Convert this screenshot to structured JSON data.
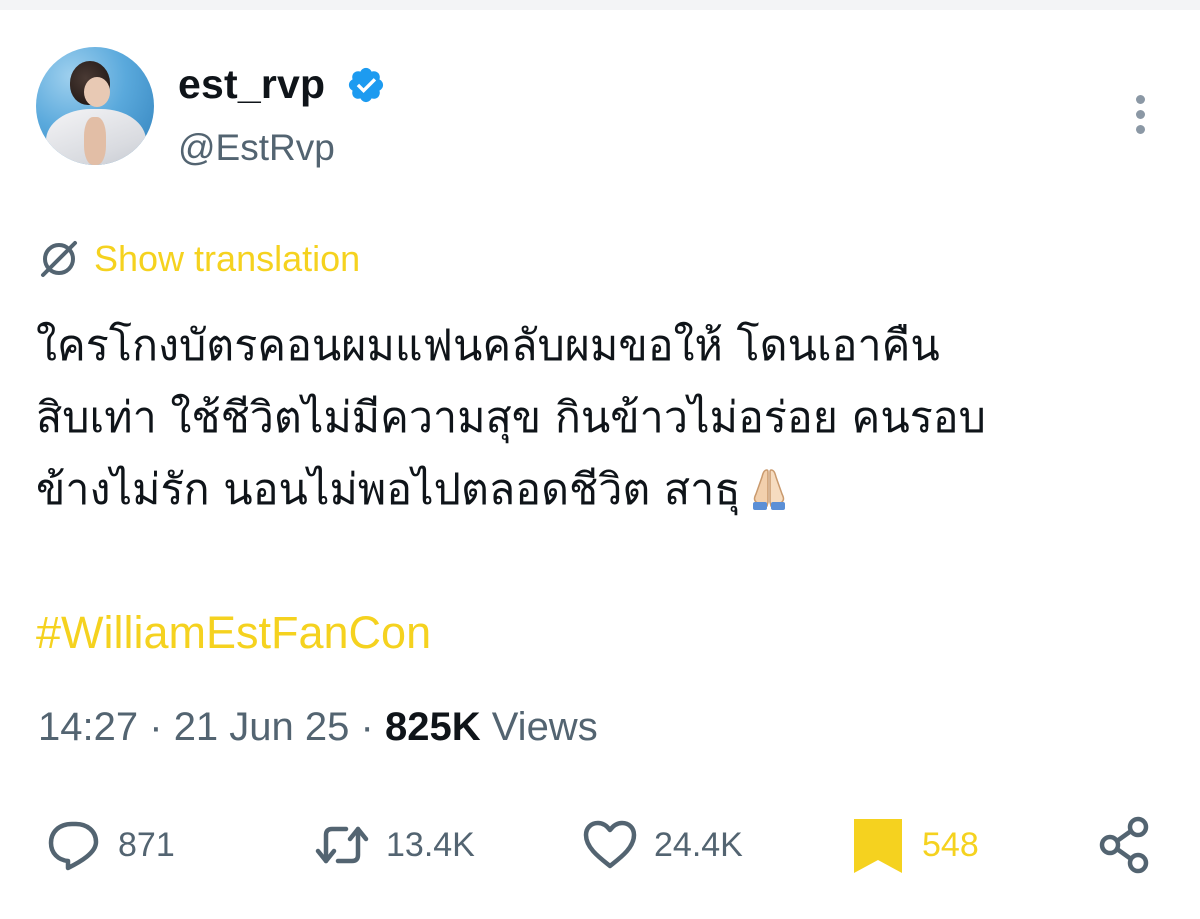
{
  "author": {
    "display_name": "est_rvp",
    "handle": "@EstRvp",
    "verified": true
  },
  "translation": {
    "link_text": "Show translation"
  },
  "tweet": {
    "lines": [
      "ใครโกงบัตรคอนผมแฟนคลับผมขอให้ โดนเอาคืน",
      "สิบเท่า ใช้ชีวิตไม่มีความสุข กินข้าวไม่อร่อย คนรอบ",
      "ข้างไม่รัก นอนไม่พอไปตลอดชีวิต สาธุ"
    ],
    "emoji": "folded-hands",
    "hashtag": "#WilliamEstFanCon"
  },
  "meta": {
    "time": "14:27",
    "separator": "·",
    "date": "21 Jun 25",
    "views_count": "825K",
    "views_label": "Views"
  },
  "actions": {
    "replies": "871",
    "reposts": "13.4K",
    "likes": "24.4K",
    "bookmarks": "548"
  },
  "icons": {
    "verified": "verified-badge-icon",
    "more": "more-vertical-icon",
    "translate": "globe-translate-icon",
    "reply": "reply-bubble-icon",
    "repost": "repost-icon",
    "like": "heart-icon",
    "bookmark": "bookmark-icon",
    "share": "share-icon"
  },
  "colors": {
    "accent": "#f5d21f",
    "verified": "#1d9bf0",
    "text": "#0f1419",
    "muted": "#536471"
  }
}
